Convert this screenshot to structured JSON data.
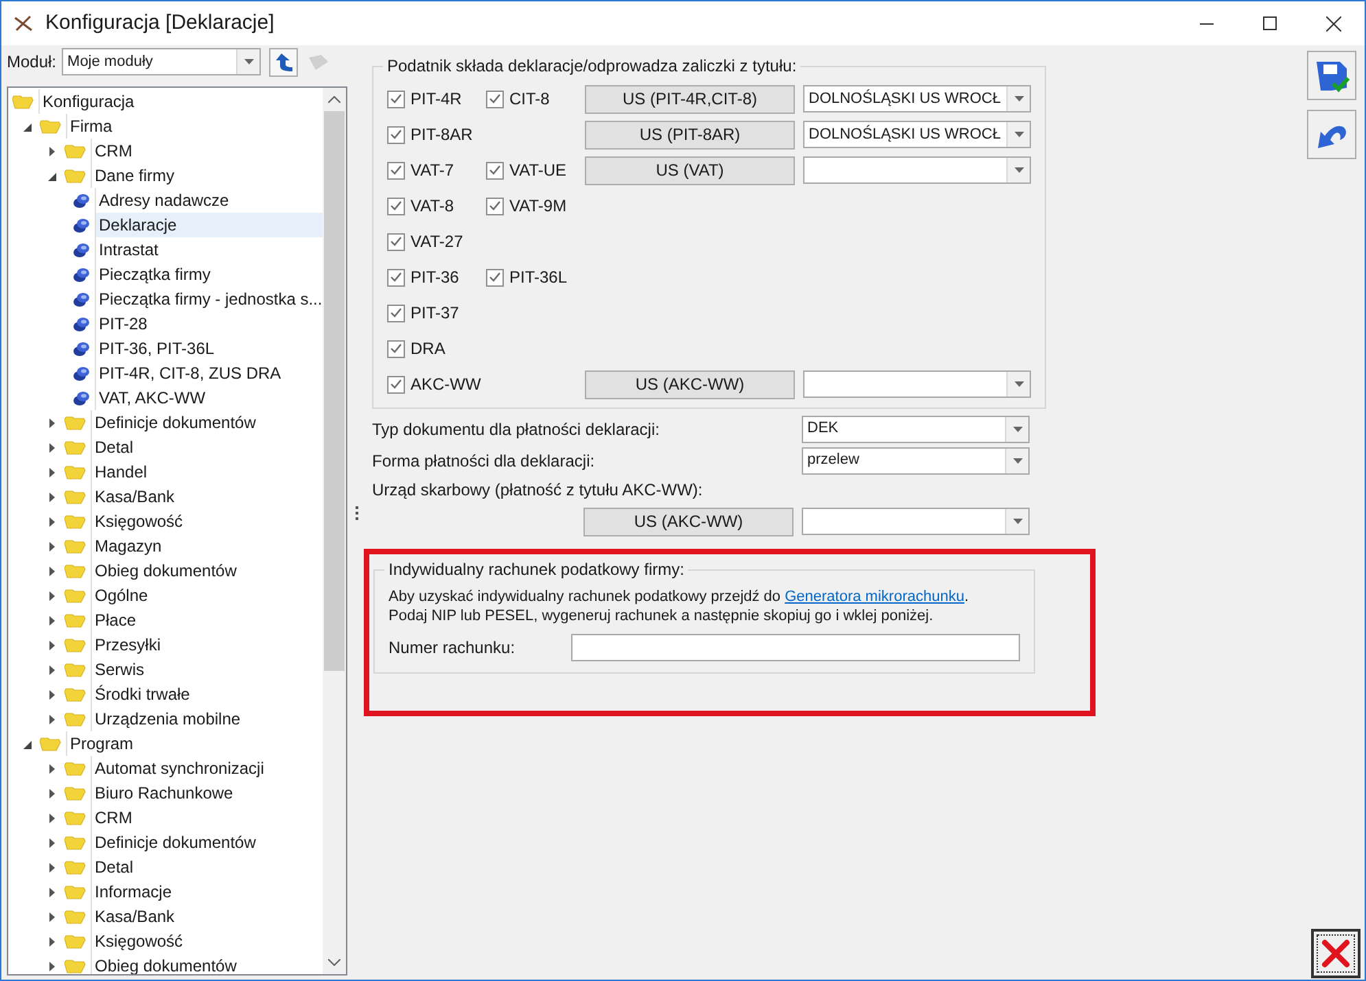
{
  "window": {
    "title": "Konfiguracja [Deklaracje]"
  },
  "module": {
    "label": "Moduł:",
    "value": "Moje moduły"
  },
  "tree": [
    {
      "label": "Konfiguracja",
      "kind": "folder",
      "selected": false,
      "children": [
        {
          "label": "Firma",
          "kind": "folder",
          "expanded": true,
          "selected": false,
          "children": [
            {
              "label": "CRM",
              "kind": "folder",
              "expanded": false,
              "selected": false
            },
            {
              "label": "Dane firmy",
              "kind": "folder",
              "expanded": true,
              "selected": false,
              "children": [
                {
                  "label": "Adresy nadawcze",
                  "kind": "setting",
                  "selected": false
                },
                {
                  "label": "Deklaracje",
                  "kind": "setting",
                  "selected": true
                },
                {
                  "label": "Intrastat",
                  "kind": "setting",
                  "selected": false
                },
                {
                  "label": "Pieczątka firmy",
                  "kind": "setting",
                  "selected": false
                },
                {
                  "label": "Pieczątka firmy - jednostka s...",
                  "kind": "setting",
                  "selected": false
                },
                {
                  "label": "PIT-28",
                  "kind": "setting",
                  "selected": false
                },
                {
                  "label": "PIT-36, PIT-36L",
                  "kind": "setting",
                  "selected": false
                },
                {
                  "label": "PIT-4R, CIT-8, ZUS DRA",
                  "kind": "setting",
                  "selected": false
                },
                {
                  "label": "VAT, AKC-WW",
                  "kind": "setting",
                  "selected": false
                }
              ]
            },
            {
              "label": "Definicje dokumentów",
              "kind": "folder",
              "expanded": false,
              "selected": false
            },
            {
              "label": "Detal",
              "kind": "folder",
              "expanded": false,
              "selected": false
            },
            {
              "label": "Handel",
              "kind": "folder",
              "expanded": false,
              "selected": false
            },
            {
              "label": "Kasa/Bank",
              "kind": "folder",
              "expanded": false,
              "selected": false
            },
            {
              "label": "Księgowość",
              "kind": "folder",
              "expanded": false,
              "selected": false
            },
            {
              "label": "Magazyn",
              "kind": "folder",
              "expanded": false,
              "selected": false
            },
            {
              "label": "Obieg dokumentów",
              "kind": "folder",
              "expanded": false,
              "selected": false
            },
            {
              "label": "Ogólne",
              "kind": "folder",
              "expanded": false,
              "selected": false
            },
            {
              "label": "Płace",
              "kind": "folder",
              "expanded": false,
              "selected": false
            },
            {
              "label": "Przesyłki",
              "kind": "folder",
              "expanded": false,
              "selected": false
            },
            {
              "label": "Serwis",
              "kind": "folder",
              "expanded": false,
              "selected": false
            },
            {
              "label": "Środki trwałe",
              "kind": "folder",
              "expanded": false,
              "selected": false
            },
            {
              "label": "Urządzenia mobilne",
              "kind": "folder",
              "expanded": false,
              "selected": false
            }
          ]
        },
        {
          "label": "Program",
          "kind": "folder",
          "expanded": true,
          "selected": false,
          "children": [
            {
              "label": "Automat synchronizacji",
              "kind": "folder",
              "expanded": false,
              "selected": false
            },
            {
              "label": "Biuro Rachunkowe",
              "kind": "folder",
              "expanded": false,
              "selected": false
            },
            {
              "label": "CRM",
              "kind": "folder",
              "expanded": false,
              "selected": false
            },
            {
              "label": "Definicje dokumentów",
              "kind": "folder",
              "expanded": false,
              "selected": false
            },
            {
              "label": "Detal",
              "kind": "folder",
              "expanded": false,
              "selected": false
            },
            {
              "label": "Informacje",
              "kind": "folder",
              "expanded": false,
              "selected": false
            },
            {
              "label": "Kasa/Bank",
              "kind": "folder",
              "expanded": false,
              "selected": false
            },
            {
              "label": "Księgowość",
              "kind": "folder",
              "expanded": false,
              "selected": false
            },
            {
              "label": "Obieg dokumentów",
              "kind": "folder",
              "expanded": false,
              "selected": false
            }
          ]
        }
      ]
    }
  ],
  "declarations": {
    "title": "Podatnik składa deklaracje/odprowadza zaliczki z tytułu:",
    "rows": [
      {
        "checks": [
          {
            "label": "PIT-4R",
            "checked": true
          },
          {
            "label": "CIT-8",
            "checked": true
          }
        ],
        "office_button": "US (PIT-4R,CIT-8)",
        "office_value": "DOLNOŚLĄSKI US WROCŁ"
      },
      {
        "checks": [
          {
            "label": "PIT-8AR",
            "checked": true
          }
        ],
        "office_button": "US (PIT-8AR)",
        "office_value": "DOLNOŚLĄSKI US WROCŁ"
      },
      {
        "checks": [
          {
            "label": "VAT-7",
            "checked": true
          },
          {
            "label": "VAT-UE",
            "checked": true
          }
        ],
        "office_button": "US (VAT)"
      },
      {
        "checks": [
          {
            "label": "VAT-8",
            "checked": true
          },
          {
            "label": "VAT-9M",
            "checked": true
          }
        ]
      },
      {
        "checks": [
          {
            "label": "VAT-27",
            "checked": true
          }
        ]
      },
      {
        "checks": [
          {
            "label": "PIT-36",
            "checked": true
          },
          {
            "label": "PIT-36L",
            "checked": true
          }
        ]
      },
      {
        "checks": [
          {
            "label": "PIT-37",
            "checked": true
          }
        ]
      },
      {
        "checks": [
          {
            "label": "DRA",
            "checked": true
          }
        ]
      },
      {
        "checks": [
          {
            "label": "AKC-WW",
            "checked": true
          }
        ],
        "office_button": "US (AKC-WW)"
      }
    ]
  },
  "payment": {
    "document_type": {
      "label": "Typ dokumentu dla płatności deklaracji:",
      "value": "DEK"
    },
    "payment_form": {
      "label": "Forma płatności dla deklaracji:",
      "value": "przelew"
    },
    "tax_office": {
      "label": "Urząd skarbowy (płatność z tytułu AKC-WW):",
      "button": "US (AKC-WW)"
    }
  },
  "account": {
    "title": "Indywidualny rachunek podatkowy firmy:",
    "text_before_link": "Aby uzyskać indywidualny rachunek podatkowy przejdź do ",
    "link": "Generatora mikrorachunku",
    "text_after_link": ".",
    "text_line2": "Podaj NIP lub PESEL, wygeneruj rachunek a następnie skopiuj go i wklej poniżej.",
    "field_label": "Numer rachunku:"
  }
}
